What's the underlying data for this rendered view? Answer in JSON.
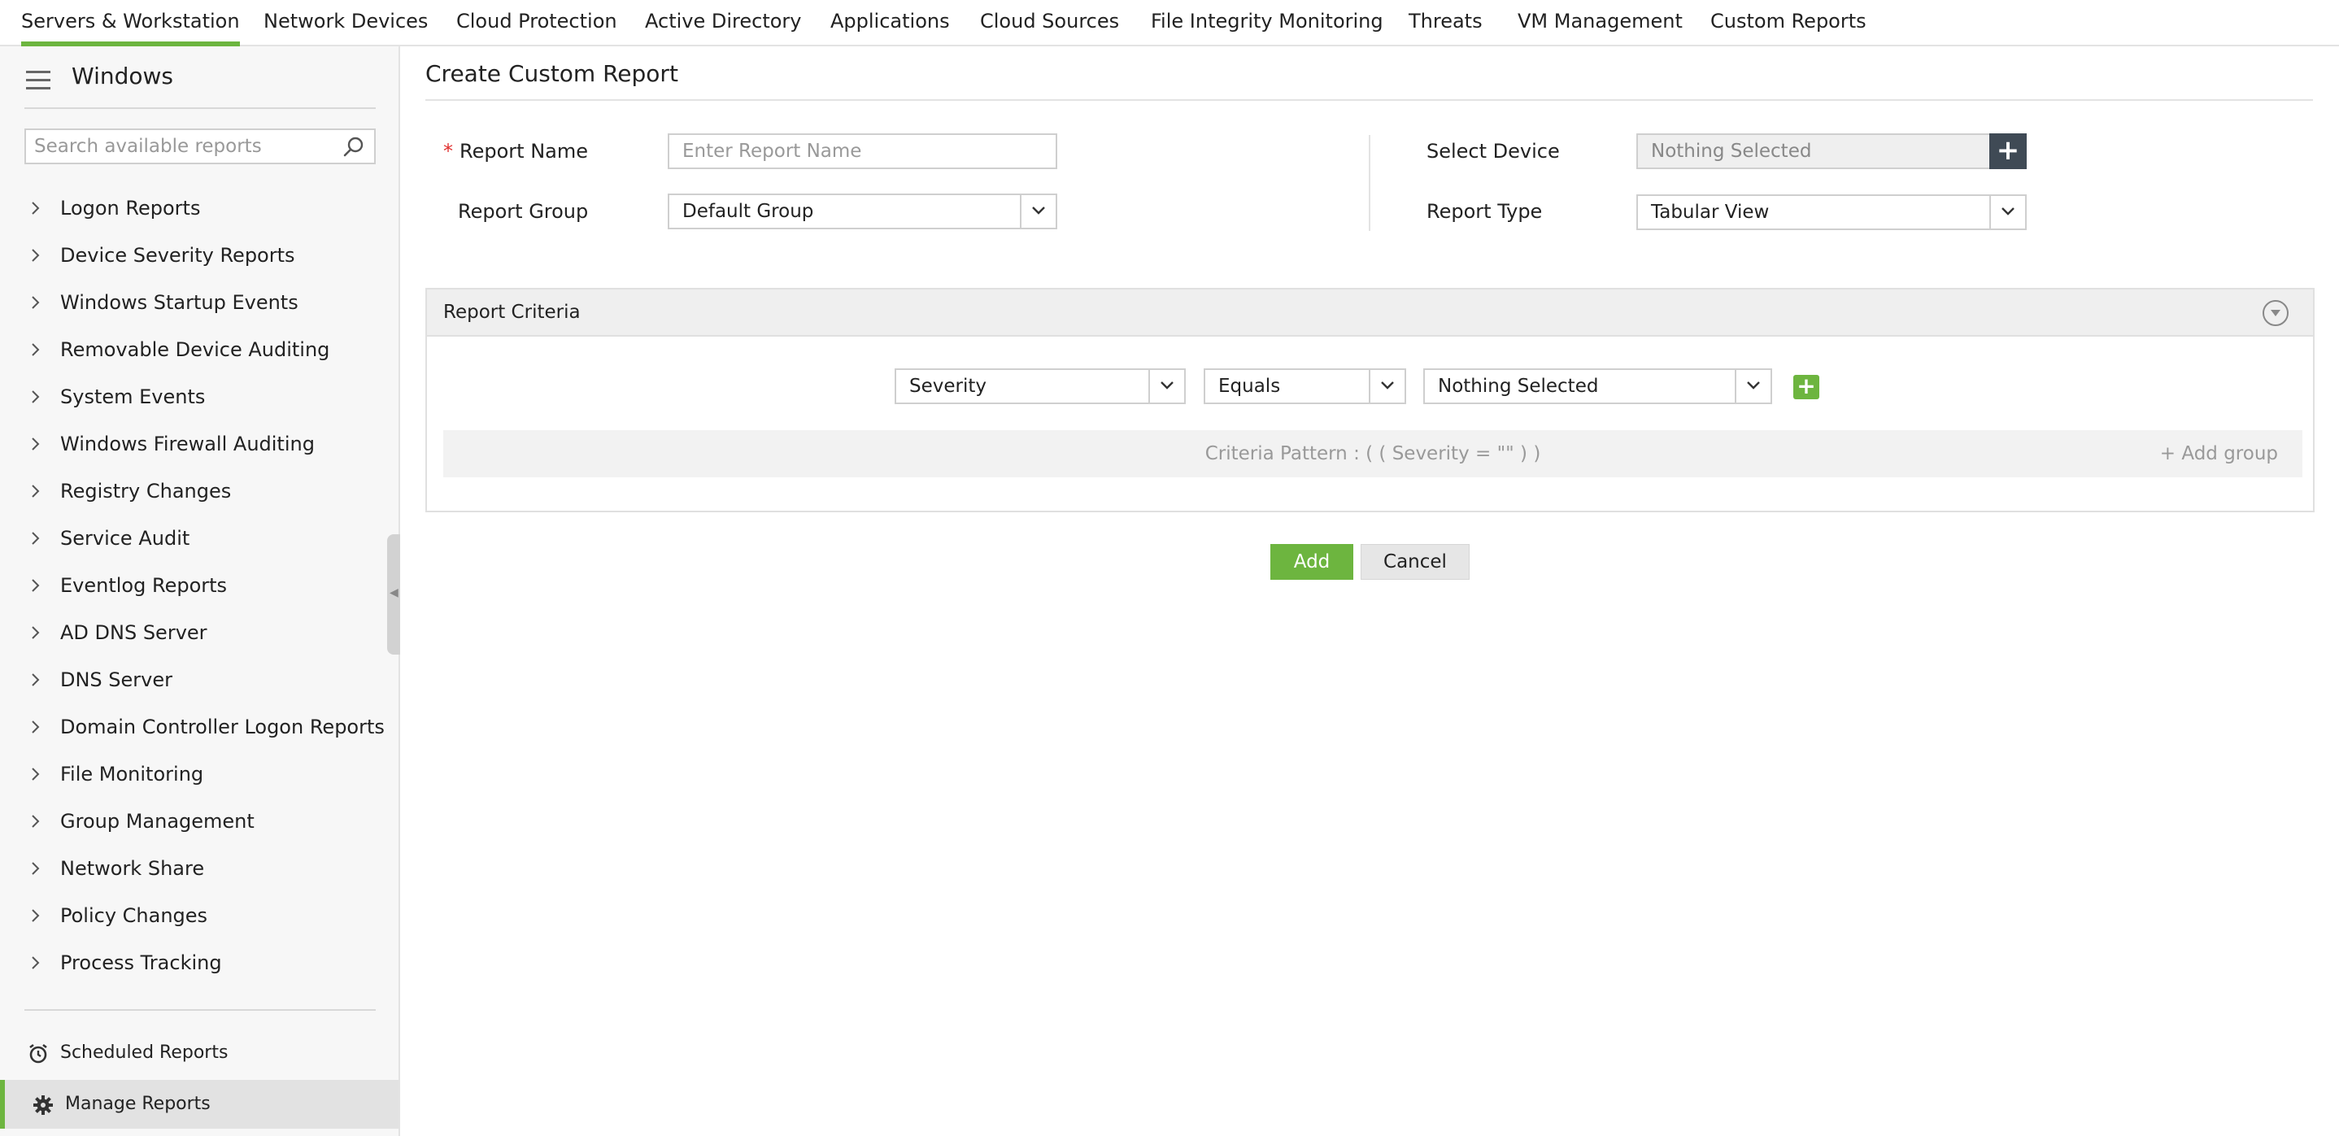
{
  "topnav": {
    "tabs": [
      {
        "label": "Servers & Workstation",
        "active": true
      },
      {
        "label": "Network Devices"
      },
      {
        "label": "Cloud Protection"
      },
      {
        "label": "Active Directory"
      },
      {
        "label": "Applications"
      },
      {
        "label": "Cloud Sources"
      },
      {
        "label": "File Integrity Monitoring"
      },
      {
        "label": "Threats"
      },
      {
        "label": "VM Management"
      },
      {
        "label": "Custom Reports"
      }
    ]
  },
  "sidebar": {
    "title": "Windows",
    "search_placeholder": "Search available reports",
    "items": [
      {
        "label": "Logon Reports"
      },
      {
        "label": "Device Severity Reports"
      },
      {
        "label": "Windows Startup Events"
      },
      {
        "label": "Removable Device Auditing"
      },
      {
        "label": "System Events"
      },
      {
        "label": "Windows Firewall Auditing"
      },
      {
        "label": "Registry Changes"
      },
      {
        "label": "Service Audit"
      },
      {
        "label": "Eventlog Reports"
      },
      {
        "label": "AD DNS Server"
      },
      {
        "label": "DNS Server"
      },
      {
        "label": "Domain Controller Logon Reports"
      },
      {
        "label": "File Monitoring"
      },
      {
        "label": "Group Management"
      },
      {
        "label": "Network Share"
      },
      {
        "label": "Policy Changes"
      },
      {
        "label": "Process Tracking"
      }
    ],
    "scheduled_reports": "Scheduled Reports",
    "manage_reports": "Manage Reports"
  },
  "form": {
    "title": "Create Custom Report",
    "report_name_label": "Report Name",
    "report_name_placeholder": "Enter Report Name",
    "report_group_label": "Report Group",
    "report_group_value": "Default Group",
    "select_device_label": "Select Device",
    "select_device_value": "Nothing Selected",
    "report_type_label": "Report Type",
    "report_type_value": "Tabular View"
  },
  "criteria": {
    "title": "Report Criteria",
    "field": "Severity",
    "operator": "Equals",
    "value": "Nothing Selected",
    "pattern": "Criteria Pattern : ( ( Severity = \"\" ) )",
    "add_group": "Add group"
  },
  "buttons": {
    "add": "Add",
    "cancel": "Cancel"
  },
  "colors": {
    "accent": "#6db53f",
    "dark_button": "#3f4a55",
    "required": "#e0302f"
  }
}
